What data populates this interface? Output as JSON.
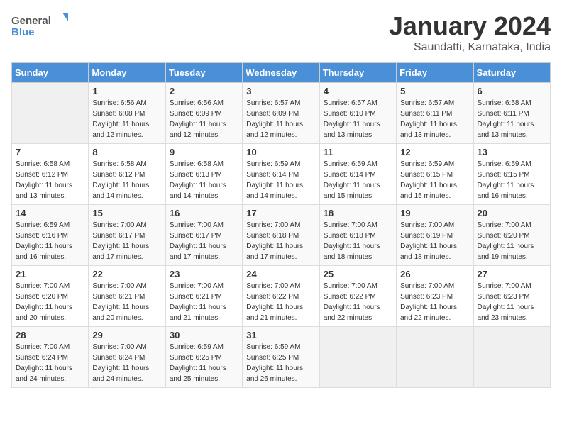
{
  "header": {
    "logo_general": "General",
    "logo_blue": "Blue",
    "month_title": "January 2024",
    "subtitle": "Saundatti, Karnataka, India"
  },
  "days_of_week": [
    "Sunday",
    "Monday",
    "Tuesday",
    "Wednesday",
    "Thursday",
    "Friday",
    "Saturday"
  ],
  "weeks": [
    [
      {
        "day": "",
        "info": ""
      },
      {
        "day": "1",
        "info": "Sunrise: 6:56 AM\nSunset: 6:08 PM\nDaylight: 11 hours and 12 minutes."
      },
      {
        "day": "2",
        "info": "Sunrise: 6:56 AM\nSunset: 6:09 PM\nDaylight: 11 hours and 12 minutes."
      },
      {
        "day": "3",
        "info": "Sunrise: 6:57 AM\nSunset: 6:09 PM\nDaylight: 11 hours and 12 minutes."
      },
      {
        "day": "4",
        "info": "Sunrise: 6:57 AM\nSunset: 6:10 PM\nDaylight: 11 hours and 13 minutes."
      },
      {
        "day": "5",
        "info": "Sunrise: 6:57 AM\nSunset: 6:11 PM\nDaylight: 11 hours and 13 minutes."
      },
      {
        "day": "6",
        "info": "Sunrise: 6:58 AM\nSunset: 6:11 PM\nDaylight: 11 hours and 13 minutes."
      }
    ],
    [
      {
        "day": "7",
        "info": "Sunrise: 6:58 AM\nSunset: 6:12 PM\nDaylight: 11 hours and 13 minutes."
      },
      {
        "day": "8",
        "info": "Sunrise: 6:58 AM\nSunset: 6:12 PM\nDaylight: 11 hours and 14 minutes."
      },
      {
        "day": "9",
        "info": "Sunrise: 6:58 AM\nSunset: 6:13 PM\nDaylight: 11 hours and 14 minutes."
      },
      {
        "day": "10",
        "info": "Sunrise: 6:59 AM\nSunset: 6:14 PM\nDaylight: 11 hours and 14 minutes."
      },
      {
        "day": "11",
        "info": "Sunrise: 6:59 AM\nSunset: 6:14 PM\nDaylight: 11 hours and 15 minutes."
      },
      {
        "day": "12",
        "info": "Sunrise: 6:59 AM\nSunset: 6:15 PM\nDaylight: 11 hours and 15 minutes."
      },
      {
        "day": "13",
        "info": "Sunrise: 6:59 AM\nSunset: 6:15 PM\nDaylight: 11 hours and 16 minutes."
      }
    ],
    [
      {
        "day": "14",
        "info": "Sunrise: 6:59 AM\nSunset: 6:16 PM\nDaylight: 11 hours and 16 minutes."
      },
      {
        "day": "15",
        "info": "Sunrise: 7:00 AM\nSunset: 6:17 PM\nDaylight: 11 hours and 17 minutes."
      },
      {
        "day": "16",
        "info": "Sunrise: 7:00 AM\nSunset: 6:17 PM\nDaylight: 11 hours and 17 minutes."
      },
      {
        "day": "17",
        "info": "Sunrise: 7:00 AM\nSunset: 6:18 PM\nDaylight: 11 hours and 17 minutes."
      },
      {
        "day": "18",
        "info": "Sunrise: 7:00 AM\nSunset: 6:18 PM\nDaylight: 11 hours and 18 minutes."
      },
      {
        "day": "19",
        "info": "Sunrise: 7:00 AM\nSunset: 6:19 PM\nDaylight: 11 hours and 18 minutes."
      },
      {
        "day": "20",
        "info": "Sunrise: 7:00 AM\nSunset: 6:20 PM\nDaylight: 11 hours and 19 minutes."
      }
    ],
    [
      {
        "day": "21",
        "info": "Sunrise: 7:00 AM\nSunset: 6:20 PM\nDaylight: 11 hours and 20 minutes."
      },
      {
        "day": "22",
        "info": "Sunrise: 7:00 AM\nSunset: 6:21 PM\nDaylight: 11 hours and 20 minutes."
      },
      {
        "day": "23",
        "info": "Sunrise: 7:00 AM\nSunset: 6:21 PM\nDaylight: 11 hours and 21 minutes."
      },
      {
        "day": "24",
        "info": "Sunrise: 7:00 AM\nSunset: 6:22 PM\nDaylight: 11 hours and 21 minutes."
      },
      {
        "day": "25",
        "info": "Sunrise: 7:00 AM\nSunset: 6:22 PM\nDaylight: 11 hours and 22 minutes."
      },
      {
        "day": "26",
        "info": "Sunrise: 7:00 AM\nSunset: 6:23 PM\nDaylight: 11 hours and 22 minutes."
      },
      {
        "day": "27",
        "info": "Sunrise: 7:00 AM\nSunset: 6:23 PM\nDaylight: 11 hours and 23 minutes."
      }
    ],
    [
      {
        "day": "28",
        "info": "Sunrise: 7:00 AM\nSunset: 6:24 PM\nDaylight: 11 hours and 24 minutes."
      },
      {
        "day": "29",
        "info": "Sunrise: 7:00 AM\nSunset: 6:24 PM\nDaylight: 11 hours and 24 minutes."
      },
      {
        "day": "30",
        "info": "Sunrise: 6:59 AM\nSunset: 6:25 PM\nDaylight: 11 hours and 25 minutes."
      },
      {
        "day": "31",
        "info": "Sunrise: 6:59 AM\nSunset: 6:25 PM\nDaylight: 11 hours and 26 minutes."
      },
      {
        "day": "",
        "info": ""
      },
      {
        "day": "",
        "info": ""
      },
      {
        "day": "",
        "info": ""
      }
    ]
  ]
}
